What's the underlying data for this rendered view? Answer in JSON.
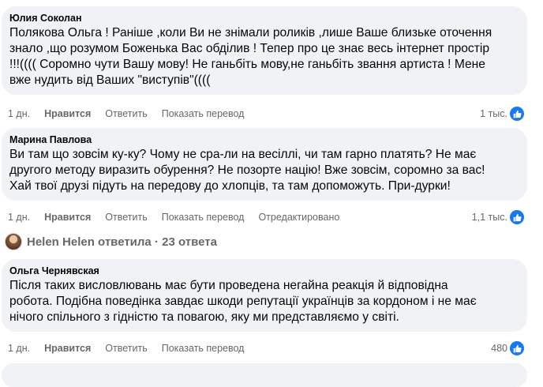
{
  "comments": [
    {
      "author": "Юлия Соколан",
      "text": "Полякова Ольга ! Раніше ,коли Ви не знімали роликів ,лише Ваше близьке оточення\nзнало ,що розумом Боженька Вас обділив ! Тепер про це знає весь інтернет простір\n!!!(((( Соромно чути Вашу мову! Не ганьбіть мову,не ганьбіть звання артиста ! Мене\nвже нудить від Ваших \"виступів\"((((",
      "time": "1 дн.",
      "like": "Нравится",
      "reply": "Ответить",
      "translate": "Показать перевод",
      "reactions": "1 тыс."
    },
    {
      "author": "Марина Павлова",
      "text": "Ви там що зовсім ку-ку? Чому не сра-ли на весіллі, чи там гарно платять? Не має\nдругого методу виразить обурення? Не позорте націю! Вже зовсім, соромно за вас!\nХай твої друзі підуть на передову до хлопців, та там допоможуть. При-дурки!",
      "time": "1 дн.",
      "like": "Нравится",
      "reply": "Ответить",
      "translate": "Показать перевод",
      "edited": "Отредактировано",
      "reactions": "1,1 тыс."
    },
    {
      "author": "Ольга Чернявская",
      "text": "Після таких висловлювань має бути проведена негайна реакція й відповідна\nробота. Подібна поведінка завдає шкоди репутації українців за кордоном і не має\nнічого спільного з гідністю та повагою, яку ми представляємо у світі.",
      "time": "1 дн.",
      "like": "Нравится",
      "reply": "Ответить",
      "translate": "Показать перевод",
      "reactions": "480"
    }
  ],
  "replies_link": "Helen Helen ответила · 23 ответа",
  "colors": {
    "bubble": "#f0f2f5",
    "like_blue": "#1877f2",
    "meta_gray": "#65676b"
  },
  "icons": {
    "reaction": "thumbs-up-icon",
    "avatar": "user-avatar"
  }
}
